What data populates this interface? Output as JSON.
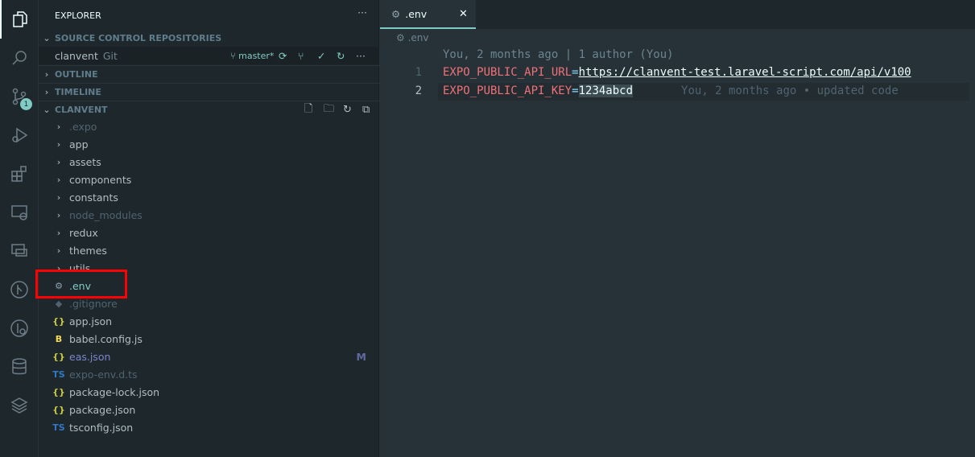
{
  "activity_bar": {
    "items": [
      "explorer",
      "search",
      "source-control",
      "run-debug",
      "extensions",
      "remote-explorer",
      "live-share",
      "git-graph",
      "git-lens",
      "database",
      "layers"
    ],
    "source_control_badge": "1"
  },
  "sidebar": {
    "title": "EXPLORER",
    "more": "···",
    "sections": {
      "scm": "SOURCE CONTROL REPOSITORIES",
      "outline": "OUTLINE",
      "timeline": "TIMELINE",
      "workspace": "CLANVENT"
    },
    "repo": {
      "name": "clanvent",
      "type": "Git",
      "branch": "master*"
    },
    "tree": [
      {
        "name": ".expo",
        "kind": "folder",
        "dim": true
      },
      {
        "name": "app",
        "kind": "folder"
      },
      {
        "name": "assets",
        "kind": "folder"
      },
      {
        "name": "components",
        "kind": "folder"
      },
      {
        "name": "constants",
        "kind": "folder"
      },
      {
        "name": "node_modules",
        "kind": "folder",
        "dim": true
      },
      {
        "name": "redux",
        "kind": "folder"
      },
      {
        "name": "themes",
        "kind": "folder"
      },
      {
        "name": "utils",
        "kind": "folder"
      },
      {
        "name": ".env",
        "kind": "gear",
        "selected": true
      },
      {
        "name": ".gitignore",
        "kind": "git",
        "dim": true
      },
      {
        "name": "app.json",
        "kind": "json"
      },
      {
        "name": "babel.config.js",
        "kind": "babel"
      },
      {
        "name": "eas.json",
        "kind": "json",
        "status": "M"
      },
      {
        "name": "expo-env.d.ts",
        "kind": "ts",
        "dim": true
      },
      {
        "name": "package-lock.json",
        "kind": "json"
      },
      {
        "name": "package.json",
        "kind": "json"
      },
      {
        "name": "tsconfig.json",
        "kind": "tsconfig"
      }
    ]
  },
  "editor": {
    "tab": ".env",
    "breadcrumb": ".env",
    "codelens": "You, 2 months ago | 1 author (You)",
    "lines": [
      {
        "num": "1",
        "key": "EXPO_PUBLIC_API_URL",
        "value": "https://clanvent-test.laravel-script.com/api/v100"
      },
      {
        "num": "2",
        "key": "EXPO_PUBLIC_API_KEY",
        "value": "1234abcd",
        "blame": "You, 2 months ago • updated code"
      }
    ]
  },
  "colors": {
    "accent": "#80cbc4",
    "highlight_box": "#ff0000",
    "key": "#f07178"
  }
}
